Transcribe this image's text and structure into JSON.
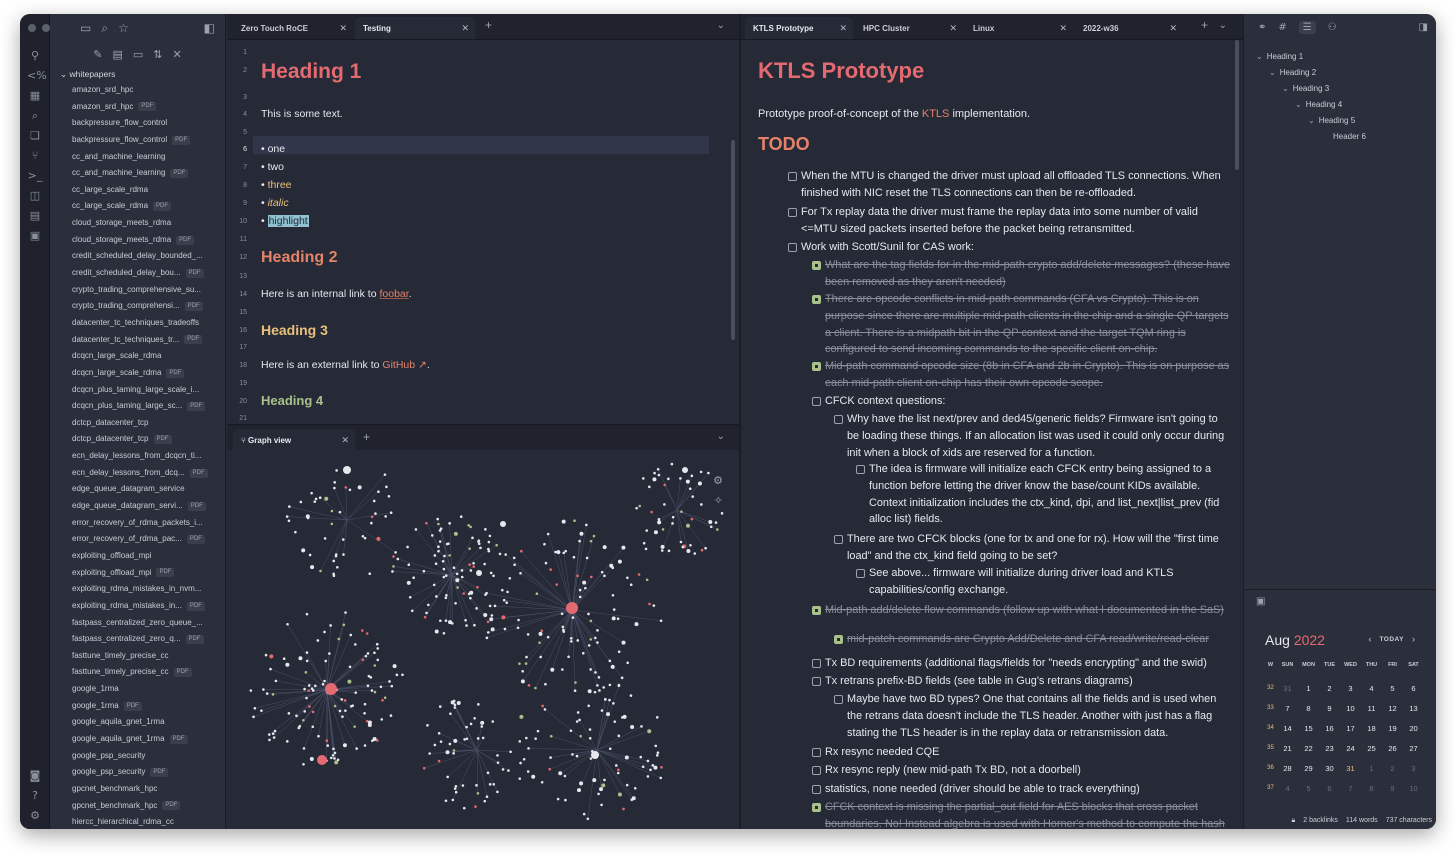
{
  "explorer": {
    "folder": "whitepapers",
    "files": [
      {
        "name": "amazon_srd_hpc",
        "pdf": false
      },
      {
        "name": "amazon_srd_hpc",
        "pdf": true
      },
      {
        "name": "backpressure_flow_control",
        "pdf": false
      },
      {
        "name": "backpressure_flow_control",
        "pdf": true
      },
      {
        "name": "cc_and_machine_learning",
        "pdf": false
      },
      {
        "name": "cc_and_machine_learning",
        "pdf": true
      },
      {
        "name": "cc_large_scale_rdma",
        "pdf": false
      },
      {
        "name": "cc_large_scale_rdma",
        "pdf": true
      },
      {
        "name": "cloud_storage_meets_rdma",
        "pdf": false
      },
      {
        "name": "cloud_storage_meets_rdma",
        "pdf": true
      },
      {
        "name": "credit_scheduled_delay_bounded_...",
        "pdf": false
      },
      {
        "name": "credit_scheduled_delay_bou...",
        "pdf": true
      },
      {
        "name": "crypto_trading_comprehensive_su...",
        "pdf": false
      },
      {
        "name": "crypto_trading_comprehensi...",
        "pdf": true
      },
      {
        "name": "datacenter_tc_techniques_tradeoffs",
        "pdf": false
      },
      {
        "name": "datacenter_tc_techniques_tr...",
        "pdf": true
      },
      {
        "name": "dcqcn_large_scale_rdma",
        "pdf": false
      },
      {
        "name": "dcqcn_large_scale_rdma",
        "pdf": true
      },
      {
        "name": "dcqcn_plus_taming_large_scale_i...",
        "pdf": false
      },
      {
        "name": "dcqcn_plus_taming_large_sc...",
        "pdf": true
      },
      {
        "name": "dctcp_datacenter_tcp",
        "pdf": false
      },
      {
        "name": "dctcp_datacenter_tcp",
        "pdf": true
      },
      {
        "name": "ecn_delay_lessons_from_dcqcn_ti...",
        "pdf": false
      },
      {
        "name": "ecn_delay_lessons_from_dcq...",
        "pdf": true
      },
      {
        "name": "edge_queue_datagram_service",
        "pdf": false
      },
      {
        "name": "edge_queue_datagram_servi...",
        "pdf": true
      },
      {
        "name": "error_recovery_of_rdma_packets_i...",
        "pdf": false
      },
      {
        "name": "error_recovery_of_rdma_pac...",
        "pdf": true
      },
      {
        "name": "exploiting_offload_mpi",
        "pdf": false
      },
      {
        "name": "exploiting_offload_mpi",
        "pdf": true
      },
      {
        "name": "exploiting_rdma_mistakes_in_nvm...",
        "pdf": false
      },
      {
        "name": "exploiting_rdma_mistakes_in...",
        "pdf": true
      },
      {
        "name": "fastpass_centralized_zero_queue_...",
        "pdf": false
      },
      {
        "name": "fastpass_centralized_zero_q...",
        "pdf": true
      },
      {
        "name": "fasttune_timely_precise_cc",
        "pdf": false
      },
      {
        "name": "fasttune_timely_precise_cc",
        "pdf": true
      },
      {
        "name": "google_1rma",
        "pdf": false
      },
      {
        "name": "google_1rma",
        "pdf": true
      },
      {
        "name": "google_aquila_gnet_1rma",
        "pdf": false
      },
      {
        "name": "google_aquila_gnet_1rma",
        "pdf": true
      },
      {
        "name": "google_psp_security",
        "pdf": false
      },
      {
        "name": "google_psp_security",
        "pdf": true
      },
      {
        "name": "gpcnet_benchmark_hpc",
        "pdf": false
      },
      {
        "name": "gpcnet_benchmark_hpc",
        "pdf": true
      },
      {
        "name": "hiercc_hierarchical_rdma_cc",
        "pdf": false
      }
    ],
    "pdf_badge": "PDF"
  },
  "left_tabs": [
    {
      "label": "Zero Touch RoCE",
      "active": false
    },
    {
      "label": "Testing",
      "active": true
    }
  ],
  "editor_lines": [
    {
      "n": "1",
      "text": "",
      "cls": ""
    },
    {
      "n": "2",
      "text": "Heading 1",
      "cls": "h1"
    },
    {
      "n": "3",
      "text": "",
      "cls": ""
    },
    {
      "n": "4",
      "text": "This is some text.",
      "cls": ""
    },
    {
      "n": "5",
      "text": "",
      "cls": ""
    },
    {
      "n": "6",
      "text": "one",
      "cls": "bul"
    },
    {
      "n": "7",
      "text": "two",
      "cls": "bul"
    },
    {
      "n": "8",
      "text": "three",
      "cls": "bul"
    },
    {
      "n": "9",
      "text": "italic",
      "cls": "bul"
    },
    {
      "n": "10",
      "text": "highlight",
      "cls": "bul"
    },
    {
      "n": "11",
      "text": "",
      "cls": ""
    },
    {
      "n": "12",
      "text": "Heading 2",
      "cls": "h2"
    },
    {
      "n": "13",
      "text": "",
      "cls": ""
    },
    {
      "n": "14",
      "text": "Here is an internal link to ",
      "cls": ""
    },
    {
      "n": "15",
      "text": "",
      "cls": ""
    },
    {
      "n": "16",
      "text": "Heading 3",
      "cls": "h3"
    },
    {
      "n": "17",
      "text": "",
      "cls": ""
    },
    {
      "n": "18",
      "text": "Here is an external link to ",
      "cls": ""
    },
    {
      "n": "19",
      "text": "",
      "cls": ""
    },
    {
      "n": "20",
      "text": "Heading 4",
      "cls": "h4"
    },
    {
      "n": "21",
      "text": "",
      "cls": ""
    }
  ],
  "editor_links": {
    "internal": "foobar",
    "external": "GitHub",
    "period": "."
  },
  "graph_tab": {
    "label": "Graph view"
  },
  "right_tabs": [
    {
      "label": "KTLS Prototype",
      "active": true
    },
    {
      "label": "HPC Cluster",
      "active": false
    },
    {
      "label": "Linux",
      "active": false
    },
    {
      "label": "2022-w36",
      "active": false
    }
  ],
  "reader": {
    "title": "KTLS Prototype",
    "para_pre": "Prototype proof-of-concept of the ",
    "para_link": "KTLS",
    "para_post": " implementation.",
    "todo": "TODO",
    "tasks": [
      {
        "text": "When the MTU is changed the driver must upload all offloaded TLS connections. When finished with NIC reset the TLS connections can then be re-offloaded.",
        "done": false,
        "level": 0
      },
      {
        "text": "For Tx replay data the driver must frame the replay data into some number of valid <=MTU sized packets inserted before the packet being retransmitted.",
        "done": false,
        "level": 0
      },
      {
        "text": "Work with Scott/Sunil for CAS work:",
        "done": false,
        "level": 0
      },
      {
        "text": "What are the tag fields for in the mid-path crypto add/delete messages? (these have been removed as they aren't needed)",
        "done": true,
        "level": 1
      },
      {
        "text": "There are opcode conflicts in mid-path commands (CFA vs Crypto). This is on purpose since there are multiple mid-path clients in the chip and a single QP targets a client. There is a midpath bit in the QP context and the target TQM ring is configured to send incoming commands to the specific client on-chip.",
        "done": true,
        "level": 1
      },
      {
        "text": "Mid-path command opcode size (8b in CFA and 2b in Crypto). This is on purpose as each mid-path client on-chip has their own opcode scope.",
        "done": true,
        "level": 1
      },
      {
        "text": "CFCK context questions:",
        "done": false,
        "level": 1
      },
      {
        "text": "Why have the list next/prev and ded45/generic fields? Firmware isn't going to be loading these things. If an allocation list was used it could only occur during init when a block of xids are reserved for a function.",
        "done": false,
        "level": 2
      },
      {
        "text": "The idea is firmware will initialize each CFCK entry being assigned to a function before letting the driver know the base/count KIDs available. Context initialization includes the ctx_kind, dpi, and list_next|list_prev (fid alloc list) fields.",
        "done": false,
        "level": 3
      },
      {
        "text": "There are two CFCK blocks (one for tx and one for rx). How will the \"first time load\" and the ctx_kind field going to be set?",
        "done": false,
        "level": 2
      },
      {
        "text": "See above... firmware will initialize during driver load and KTLS capabilities/config exchange.",
        "done": false,
        "level": 3
      },
      {
        "text": "Mid-path add/delete flow commands (follow up with what I documented in the SaS)",
        "done": true,
        "level": 1
      },
      {
        "text": "mid-patch commands are Crypto Add/Delete and CFA read/write/read-clear",
        "done": true,
        "level": 2
      },
      {
        "text": "Tx BD requirements (additional flags/fields for \"needs encrypting\" and the swid)",
        "done": false,
        "level": 1
      },
      {
        "text": "Tx retrans prefix-BD fields (see table in Gug's retrans diagrams)",
        "done": false,
        "level": 1
      },
      {
        "text": "Maybe have two BD types? One that contains all the fields and is used when the retrans data doesn't include the TLS header. Another with just has a flag stating the TLS header is in the replay data or retransmission data.",
        "done": false,
        "level": 2
      },
      {
        "text": "Rx resync needed CQE",
        "done": false,
        "level": 1
      },
      {
        "text": "Rx resync reply (new mid-path Tx BD, not a doorbell)",
        "done": false,
        "level": 1
      },
      {
        "text": "statistics, none needed (driver should be able to track everything)",
        "done": false,
        "level": 1
      },
      {
        "text": "CFCK context is missing the partial_out field for AES blocks that cross packet boundaries. No! Instead algebra is used with Horner's method to compute the hash on the fly without saving prior block data.",
        "done": true,
        "level": 1
      }
    ]
  },
  "outline": [
    "Heading 1",
    "Heading 2",
    "Heading 3",
    "Heading 4",
    "Heading 5",
    "Header 6"
  ],
  "calendar": {
    "month": "Aug",
    "year": "2022",
    "today_label": "TODAY",
    "weekdays": [
      "W",
      "SUN",
      "MON",
      "TUE",
      "WED",
      "THU",
      "FRI",
      "SAT"
    ],
    "weeks": [
      [
        "32",
        "31",
        "1",
        "2",
        "3",
        "4",
        "5",
        "6"
      ],
      [
        "33",
        "7",
        "8",
        "9",
        "10",
        "11",
        "12",
        "13"
      ],
      [
        "34",
        "14",
        "15",
        "16",
        "17",
        "18",
        "19",
        "20"
      ],
      [
        "35",
        "21",
        "22",
        "23",
        "24",
        "25",
        "26",
        "27"
      ],
      [
        "36",
        "28",
        "29",
        "30",
        "31",
        "1",
        "2",
        "3"
      ],
      [
        "37",
        "4",
        "5",
        "6",
        "7",
        "8",
        "9",
        "10"
      ]
    ]
  },
  "status": {
    "backlinks": "2 backlinks",
    "words": "114 words",
    "chars": "737 characters"
  },
  "colors": {
    "accent": "#e46a71",
    "h2": "#e5826a",
    "h3": "#e8c07a",
    "h4": "#a8c08a",
    "bg": "#262a36"
  },
  "icons": [
    "folder-icon",
    "search-icon",
    "star-icon",
    "sidebar-toggle-icon",
    "new-note-icon",
    "new-folder-icon",
    "sort-icon",
    "collapse-icon",
    "settings-icon",
    "help-icon",
    "graph-settings-icon",
    "magic-icon"
  ]
}
